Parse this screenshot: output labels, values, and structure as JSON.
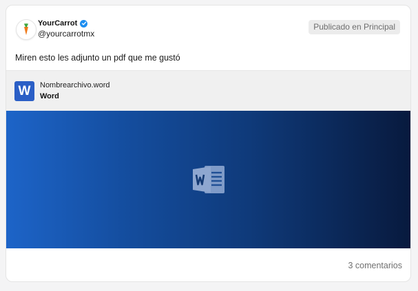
{
  "author": {
    "name": "YourCarrot",
    "handle": "@yourcarrotmx",
    "avatar_icon": "carrot-icon",
    "verified_icon": "verified-badge-icon"
  },
  "status": {
    "label": "Publicado en Principal"
  },
  "post": {
    "text": "Miren esto les adjunto un pdf que me gustó"
  },
  "attachment": {
    "icon_letter": "W",
    "file_name": "Nombrearchivo.word",
    "file_type": "Word",
    "icon_color": "#2b5fc6"
  },
  "preview": {
    "icon": "word-document-icon"
  },
  "footer": {
    "comments": "3 comentarios"
  }
}
